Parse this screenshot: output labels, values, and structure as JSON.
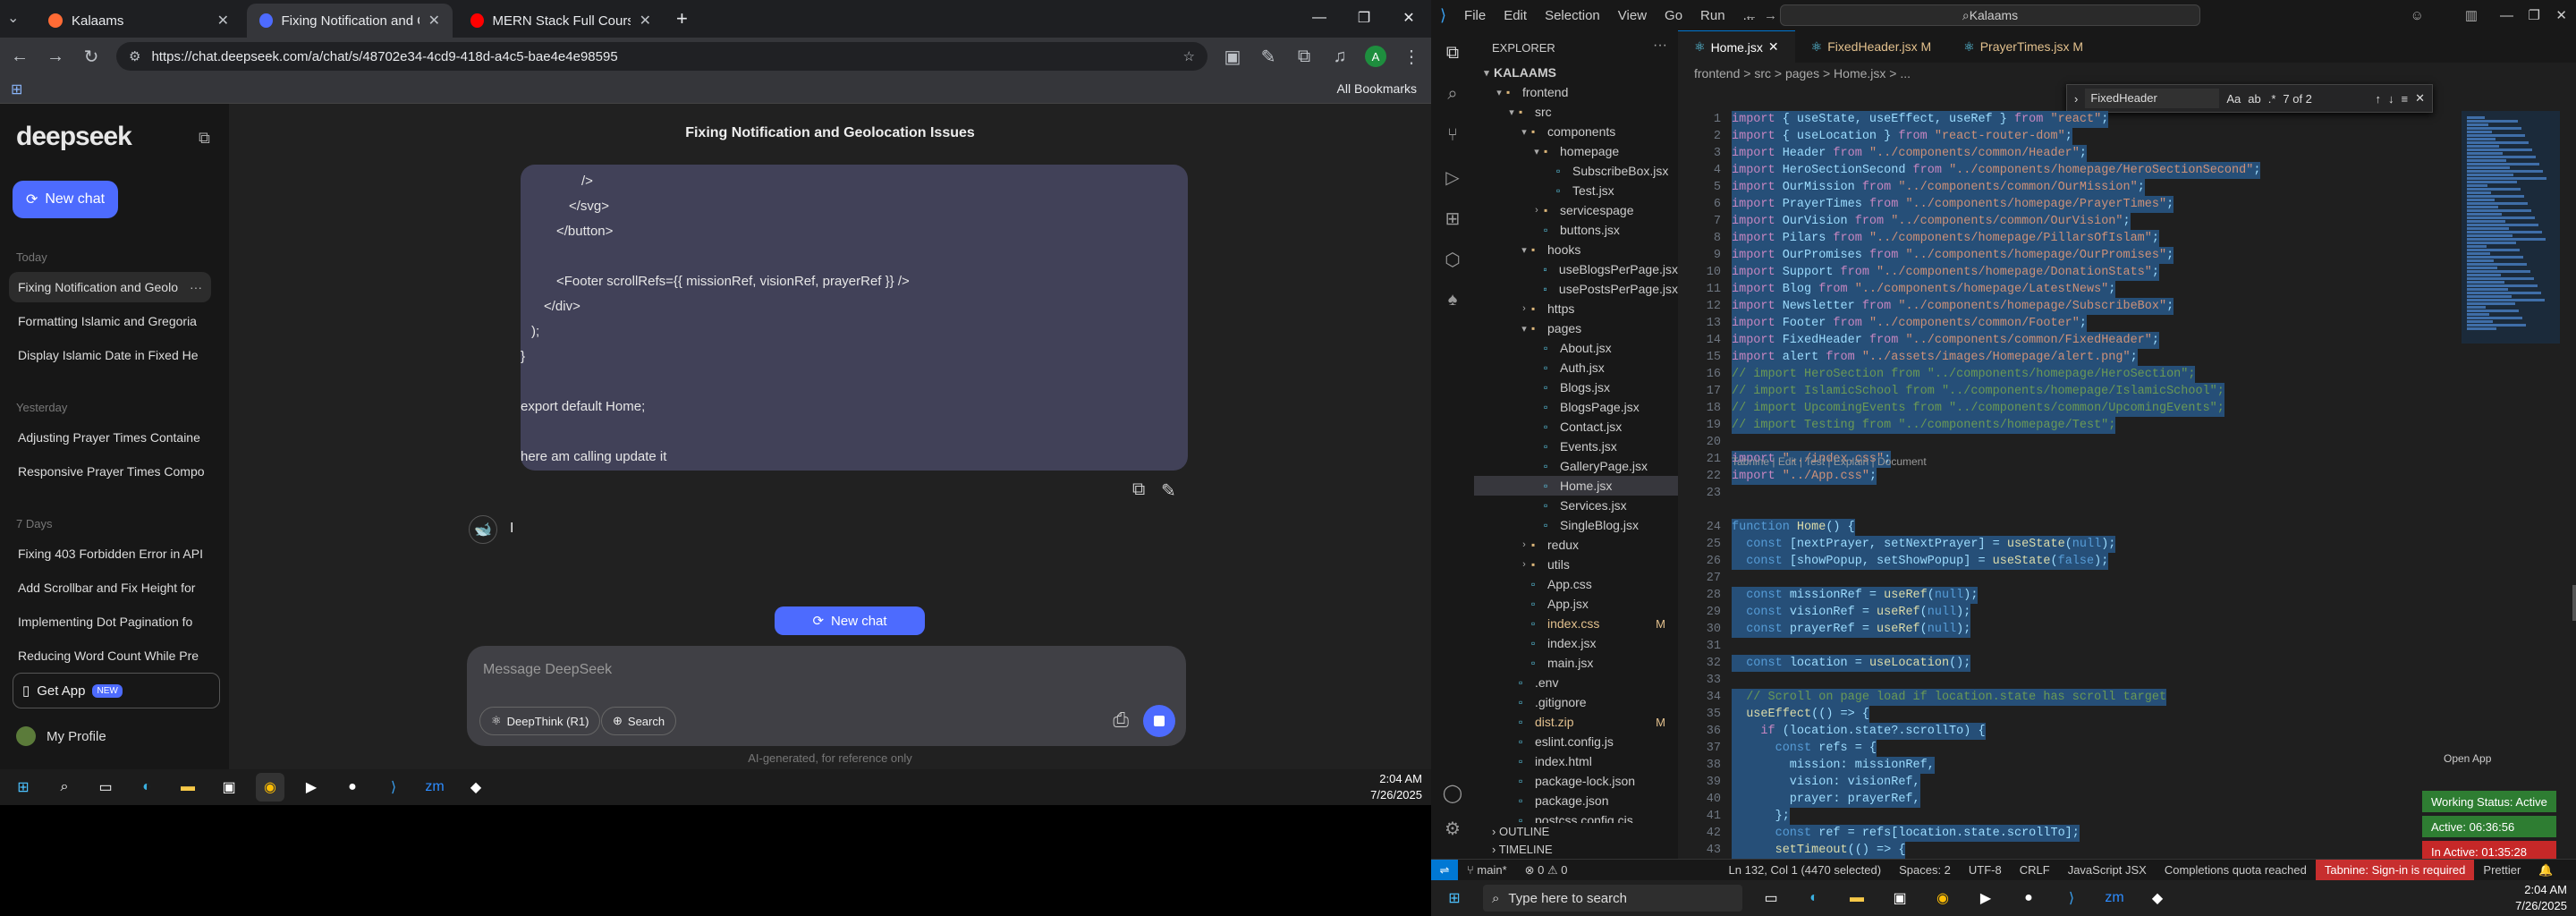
{
  "browser": {
    "tabs": [
      {
        "label": "Kalaams",
        "favicon_color": "#ff6b35"
      },
      {
        "label": "Fixing Notification and Geoloca",
        "favicon_color": "#4d6bfe"
      },
      {
        "label": "MERN Stack Full Course - ECom",
        "favicon_color": "#ff0000"
      }
    ],
    "new_tab_label": "+",
    "url": "https://chat.deepseek.com/a/chat/s/48702e34-4cd9-418d-a4c5-bae4e4e98595",
    "all_bookmarks": "All Bookmarks",
    "profile_initial": "A"
  },
  "deepseek": {
    "logo": "deepseek",
    "new_chat": "New chat",
    "sections": {
      "today": "Today",
      "yesterday": "Yesterday",
      "seven_days": "7 Days"
    },
    "today_chats": [
      "Fixing Notification and Geolo",
      "Formatting Islamic and Gregoria",
      "Display Islamic Date in Fixed He"
    ],
    "yesterday_chats": [
      "Adjusting Prayer Times Containe",
      "Responsive Prayer Times Compo"
    ],
    "week_chats": [
      "Fixing 403 Forbidden Error in API",
      "Add Scrollbar and Fix Height for",
      "Implementing Dot Pagination fo",
      "Reducing Word Count While Pre"
    ],
    "get_app": "Get App",
    "get_app_badge": "NEW",
    "my_profile": "My Profile",
    "chat_title": "Fixing Notification and Geolocation Issues",
    "user_message_lines": [
      "/>",
      "</svg>",
      "</button>",
      "",
      "<Footer scrollRefs={{ missionRef, visionRef, prayerRef }} />",
      "</div>",
      ");",
      "}",
      "",
      "export default Home;",
      "",
      "here am calling update it"
    ],
    "ai_typing": "I",
    "new_chat_pill": "New chat",
    "composer_placeholder": "Message DeepSeek",
    "deepthink": "DeepThink (R1)",
    "search": "Search",
    "disclaimer": "AI-generated, for reference only"
  },
  "taskbar_left": {
    "time": "2:04 AM",
    "date": "7/26/2025"
  },
  "vscode": {
    "menu": [
      "File",
      "Edit",
      "Selection",
      "View",
      "Go",
      "Run",
      "..."
    ],
    "search": "Kalaams",
    "explorer_header": "EXPLORER",
    "project": "KALAAMS",
    "tree": [
      {
        "label": "frontend",
        "depth": 1,
        "type": "folder-open"
      },
      {
        "label": "src",
        "depth": 2,
        "type": "folder-open"
      },
      {
        "label": "components",
        "depth": 3,
        "type": "folder-open"
      },
      {
        "label": "homepage",
        "depth": 4,
        "type": "folder-open"
      },
      {
        "label": "SubscribeBox.jsx",
        "depth": 5,
        "type": "file"
      },
      {
        "label": "Test.jsx",
        "depth": 5,
        "type": "file"
      },
      {
        "label": "servicespage",
        "depth": 4,
        "type": "folder"
      },
      {
        "label": "buttons.jsx",
        "depth": 4,
        "type": "file"
      },
      {
        "label": "hooks",
        "depth": 3,
        "type": "folder-open"
      },
      {
        "label": "useBlogsPerPage.jsx",
        "depth": 4,
        "type": "file"
      },
      {
        "label": "usePostsPerPage.jsx",
        "depth": 4,
        "type": "file"
      },
      {
        "label": "https",
        "depth": 3,
        "type": "folder"
      },
      {
        "label": "pages",
        "depth": 3,
        "type": "folder-open"
      },
      {
        "label": "About.jsx",
        "depth": 4,
        "type": "file"
      },
      {
        "label": "Auth.jsx",
        "depth": 4,
        "type": "file"
      },
      {
        "label": "Blogs.jsx",
        "depth": 4,
        "type": "file"
      },
      {
        "label": "BlogsPage.jsx",
        "depth": 4,
        "type": "file"
      },
      {
        "label": "Contact.jsx",
        "depth": 4,
        "type": "file"
      },
      {
        "label": "Events.jsx",
        "depth": 4,
        "type": "file"
      },
      {
        "label": "GalleryPage.jsx",
        "depth": 4,
        "type": "file"
      },
      {
        "label": "Home.jsx",
        "depth": 4,
        "type": "file",
        "selected": true
      },
      {
        "label": "Services.jsx",
        "depth": 4,
        "type": "file"
      },
      {
        "label": "SingleBlog.jsx",
        "depth": 4,
        "type": "file"
      },
      {
        "label": "redux",
        "depth": 3,
        "type": "folder"
      },
      {
        "label": "utils",
        "depth": 3,
        "type": "folder"
      },
      {
        "label": "App.css",
        "depth": 3,
        "type": "file"
      },
      {
        "label": "App.jsx",
        "depth": 3,
        "type": "file"
      },
      {
        "label": "index.css",
        "depth": 3,
        "type": "file",
        "mod": "M"
      },
      {
        "label": "index.jsx",
        "depth": 3,
        "type": "file"
      },
      {
        "label": "main.jsx",
        "depth": 3,
        "type": "file"
      },
      {
        "label": ".env",
        "depth": 2,
        "type": "file"
      },
      {
        "label": ".gitignore",
        "depth": 2,
        "type": "file"
      },
      {
        "label": "dist.zip",
        "depth": 2,
        "type": "file",
        "mod": "M"
      },
      {
        "label": "eslint.config.js",
        "depth": 2,
        "type": "file"
      },
      {
        "label": "index.html",
        "depth": 2,
        "type": "file"
      },
      {
        "label": "package-lock.json",
        "depth": 2,
        "type": "file"
      },
      {
        "label": "package.json",
        "depth": 2,
        "type": "file"
      },
      {
        "label": "postcss.config.cjs",
        "depth": 2,
        "type": "file"
      }
    ],
    "outline": "OUTLINE",
    "timeline": "TIMELINE",
    "editor_tabs": [
      {
        "label": "Home.jsx",
        "active": true
      },
      {
        "label": "FixedHeader.jsx M",
        "modified": true
      },
      {
        "label": "PrayerTimes.jsx M",
        "modified": true
      }
    ],
    "breadcrumb": "frontend > src > pages > Home.jsx > ...",
    "find": {
      "query": "FixedHeader",
      "count": "7 of 2"
    },
    "codelens": "Tabnine | Edit | Test | Explain | Document",
    "code_lines": [
      "import { useState, useEffect, useRef } from \"react\";",
      "import { useLocation } from \"react-router-dom\";",
      "import Header from \"../components/common/Header\";",
      "import HeroSectionSecond from \"../components/homepage/HeroSectionSecond\";",
      "import OurMission from \"../components/common/OurMission\";",
      "import PrayerTimes from \"../components/homepage/PrayerTimes\";",
      "import OurVision from \"../components/common/OurVision\";",
      "import Pilars from \"../components/homepage/PillarsOfIslam\";",
      "import OurPromises from \"../components/homepage/OurPromises\";",
      "import Support from \"../components/homepage/DonationStats\";",
      "import Blog from \"../components/homepage/LatestNews\";",
      "import Newsletter from \"../components/homepage/SubscribeBox\";",
      "import Footer from \"../components/common/Footer\";",
      "import FixedHeader from \"../components/common/FixedHeader\";",
      "import alert from \"../assets/images/Homepage/alert.png\";",
      "// import HeroSection from \"../components/homepage/HeroSection\";",
      "// import IslamicSchool from \"../components/homepage/IslamicSchool\";",
      "// import UpcomingEvents from \"../components/common/UpcomingEvents\";",
      "// import Testing from \"../components/homepage/Test\";",
      "",
      "import \"../index.css\";",
      "import \"../App.css\";",
      "",
      "function Home() {",
      "  const [nextPrayer, setNextPrayer] = useState(null);",
      "  const [showPopup, setShowPopup] = useState(false);",
      "",
      "  const missionRef = useRef(null);",
      "  const visionRef = useRef(null);",
      "  const prayerRef = useRef(null);",
      "",
      "  const location = useLocation();",
      "",
      "  // Scroll on page load if location.state has scroll target",
      "  useEffect(() => {",
      "    if (location.state?.scrollTo) {",
      "      const refs = {",
      "        mission: missionRef,",
      "        vision: visionRef,",
      "        prayer: prayerRef,",
      "      };",
      "      const ref = refs[location.state.scrollTo];",
      "      setTimeout(() => {"
    ],
    "status": {
      "branch": "main*",
      "problems": "⊗ 0 ⚠ 0",
      "position": "Ln 132, Col 1 (4470 selected)",
      "spaces": "Spaces: 2",
      "encoding": "UTF-8",
      "eol": "CRLF",
      "language": "JavaScript JSX",
      "completions": "Completions quota reached",
      "tabnine": "Tabnine: Sign-in is required",
      "prettier": "Prettier"
    },
    "open_app": "Open App",
    "working_status": "Working Status: Active",
    "active": "Active: 06:36:56",
    "inactive": "In Active: 01:35:28"
  },
  "taskbar_right": {
    "search": "Type here to search",
    "time": "2:04 AM",
    "date": "7/26/2025"
  }
}
